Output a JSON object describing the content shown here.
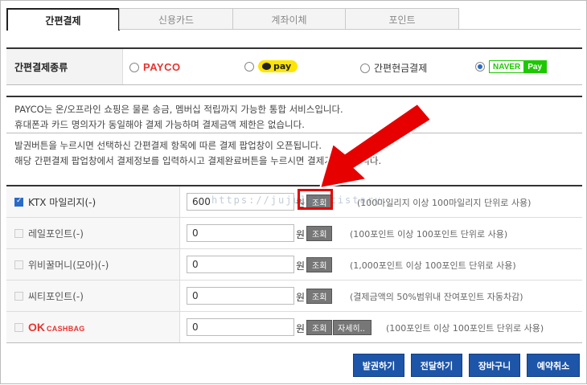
{
  "tabs": [
    {
      "label": "간편결제",
      "active": true
    },
    {
      "label": "신용카드",
      "active": false
    },
    {
      "label": "계좌이체",
      "active": false
    },
    {
      "label": "포인트",
      "active": false
    }
  ],
  "pay_type": {
    "label": "간편결제종류",
    "options": [
      {
        "label": "PAYCO",
        "selected": false
      },
      {
        "label": "pay",
        "selected": false
      },
      {
        "label": "간편현금결제",
        "selected": false
      },
      {
        "label": "NAVER",
        "label2": "Pay",
        "selected": true
      }
    ]
  },
  "info1": {
    "line1": "PAYCO는 온/오프라인 쇼핑은 물론 송금, 멤버십 적립까지 가능한 통합 서비스입니다.",
    "line2": "휴대폰과 카드 명의자가 동일해야 결제 가능하며 결제금액 제한은 없습니다."
  },
  "info2": {
    "line1": "발권버튼을 누르시면 선택하신 간편결제 항목에 따른 결제 팝업창이 오픈됩니다.",
    "line2": "해당 간편결제 팝업창에서 결제정보를 입력하시고 결제완료버튼을 누르시면 결제가 완료됩니다."
  },
  "mileage": [
    {
      "label": "KTX 마일리지(-)",
      "checked": true,
      "value": "600",
      "unit": "원",
      "button": "조회",
      "note": "(100마일리지 이상 100마일리지 단위로 사용)"
    },
    {
      "label": "레일포인트(-)",
      "checked": false,
      "value": "0",
      "unit": "원",
      "button": "조회",
      "note": "(100포인트 이상 100포인트 단위로 사용)"
    },
    {
      "label": "위비꿀머니(모아)(-)",
      "checked": false,
      "value": "0",
      "unit": "원",
      "button": "조회",
      "note": "(1,000포인트 이상 100포인트 단위로 사용)"
    },
    {
      "label": "씨티포인트(-)",
      "checked": false,
      "value": "0",
      "unit": "원",
      "button": "조회",
      "note": "(결제금액의 50%범위내 잔여포인트 자동차감)"
    },
    {
      "label": "OK",
      "label2": "CASHBAG",
      "checked": false,
      "value": "0",
      "unit": "원",
      "button": "조회",
      "detail_button": "자세히..",
      "note": "(100포인트 이상 100포인트 단위로 사용)"
    }
  ],
  "watermark": "https://jujulai.tistory",
  "buttons": {
    "issue": "발권하기",
    "deliver": "전달하기",
    "cart": "장바구니",
    "cancel": "예약취소"
  },
  "colors": {
    "accent": "#1d55a8",
    "highlight": "#e60000",
    "payco": "#e8332f",
    "naver": "#1ec800",
    "kakao": "#fee500"
  }
}
